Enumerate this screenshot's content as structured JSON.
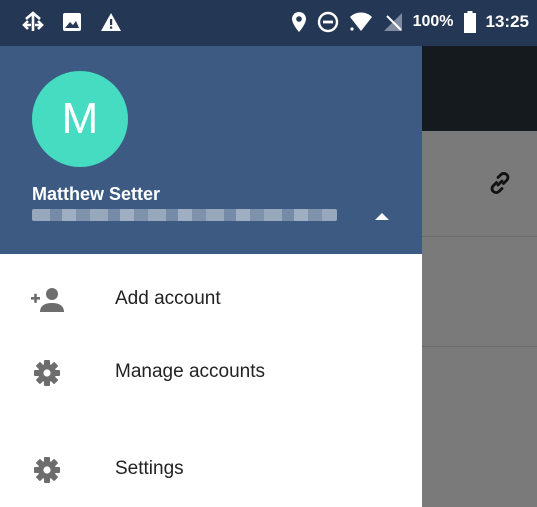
{
  "status_bar": {
    "battery_percent": "100%",
    "time": "13:25",
    "icons": [
      "cast-icon",
      "image-icon",
      "warning-icon",
      "location-icon",
      "do-not-disturb-icon",
      "wifi-icon",
      "no-signal-icon",
      "battery-icon"
    ]
  },
  "drawer": {
    "account": {
      "avatar_letter": "M",
      "avatar_color": "#45dcc1",
      "name": "Matthew Setter",
      "email_blurred": true
    },
    "header_color": "#3c5a82",
    "items": [
      {
        "label": "Add account",
        "icon": "add-person-icon"
      },
      {
        "label": "Manage accounts",
        "icon": "gear-icon"
      },
      {
        "label": "Settings",
        "icon": "gear-icon"
      }
    ]
  },
  "background_app": {
    "icon": "link-icon"
  }
}
